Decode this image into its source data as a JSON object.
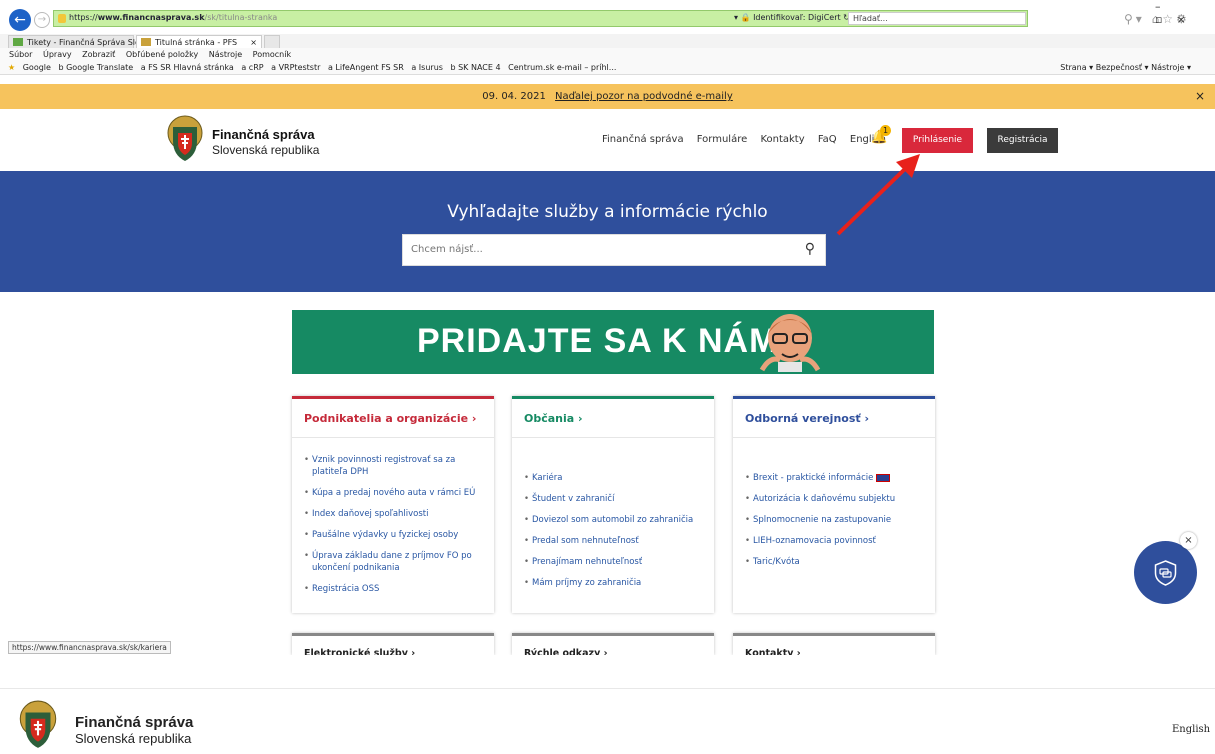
{
  "browser": {
    "url_scheme": "https://",
    "url_domain": "www.financnasprava.sk",
    "url_path": "/sk/titulna-stranka",
    "cert_label": "Identifikovaľ: DigiCert",
    "search_placeholder": "Hľadať...",
    "tabs": [
      {
        "label": "Tikety - Finančná Správa Slove..."
      },
      {
        "label": "Titulná stránka - PFS"
      }
    ],
    "menu": [
      "Súbor",
      "Úpravy",
      "Zobraziť",
      "Obľúbené položky",
      "Nástroje",
      "Pomocník"
    ],
    "favorites": [
      "Google",
      "b Google Translate",
      "a FS SR Hlavná stránka",
      "a cRP",
      "a VRPteststr",
      "a LifeAngent FS SR",
      "a Isurus",
      "b SK NACE 4",
      "Centrum.sk e-mail – príhl..."
    ],
    "fav_right": "Strana ▾  Bezpečnosť ▾  Nástroje ▾",
    "status_url": "https://www.financnasprava.sk/sk/kariera"
  },
  "alert": {
    "date": "09. 04. 2021",
    "text": "Naďalej pozor na podvodné e-maily",
    "close": "×"
  },
  "header": {
    "brand_line1": "Finančná správa",
    "brand_line2": "Slovenská republika",
    "nav": [
      "Finančná správa",
      "Formuláre",
      "Kontakty",
      "FaQ",
      "English"
    ],
    "notif_count": "1",
    "login": "Prihlásenie",
    "register": "Registrácia"
  },
  "hero": {
    "title": "Vyhľadajte služby a informácie rýchlo",
    "search_placeholder": "Chcem nájsť..."
  },
  "banner": {
    "text": "PRIDAJTE SA K NÁM!"
  },
  "cards": [
    {
      "title": "Podnikatelia a organizácie ›",
      "color": "#c52a3a",
      "items": [
        "Vznik povinnosti registrovať sa za platiteľa DPH",
        "Kúpa a predaj nového auta v rámci EÚ",
        "Index daňovej spoľahlivosti",
        "Paušálne výdavky u fyzickej osoby",
        "Úprava základu dane z príjmov FO po ukončení podnikania",
        "Registrácia OSS"
      ]
    },
    {
      "title": "Občania ›",
      "color": "#168a63",
      "items": [
        "Kariéra",
        "Študent v zahraničí",
        "Doviezol som automobil zo zahraničia",
        "Predal som nehnuteľnosť",
        "Prenajímam nehnuteľnosť",
        "Mám príjmy zo zahraničia"
      ]
    },
    {
      "title": "Odborná verejnosť ›",
      "color": "#2f4f9c",
      "items": [
        "Brexit - praktické informácie",
        "Autorizácia k daňovému subjektu",
        "Splnomocnenie na zastupovanie",
        "LIEH-oznamovacia povinnosť",
        "Taric/Kvóta"
      ]
    }
  ],
  "cards2": [
    "Elektronické služby ›",
    "Rýchle odkazy ›",
    "Kontakty ›"
  ],
  "footer": {
    "brand_line1": "Finančná správa",
    "brand_line2": "Slovenská republika",
    "english": "English"
  }
}
